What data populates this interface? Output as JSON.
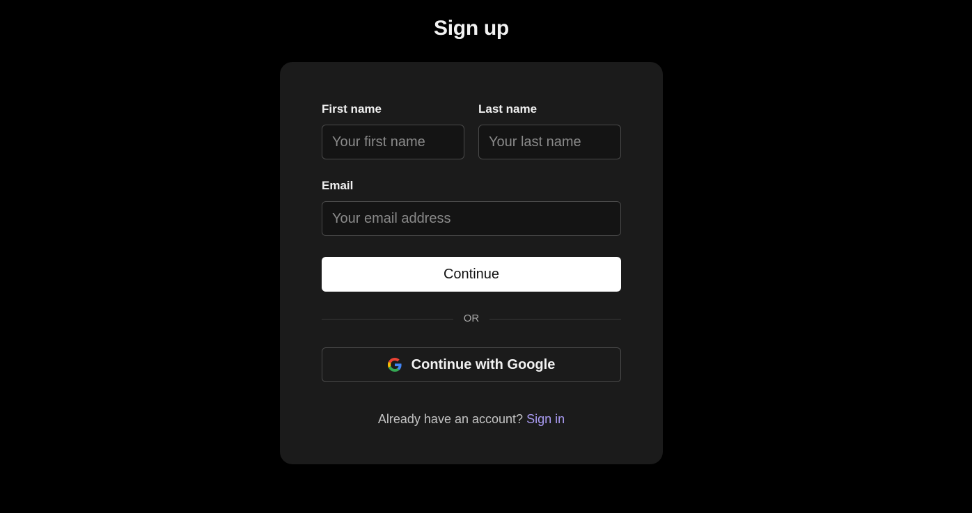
{
  "page": {
    "title": "Sign up"
  },
  "form": {
    "first_name": {
      "label": "First name",
      "placeholder": "Your first name",
      "value": ""
    },
    "last_name": {
      "label": "Last name",
      "placeholder": "Your last name",
      "value": ""
    },
    "email": {
      "label": "Email",
      "placeholder": "Your email address",
      "value": ""
    },
    "continue_label": "Continue",
    "divider_label": "OR",
    "google_label": "Continue with Google",
    "google_icon": "google-g-icon"
  },
  "footer": {
    "prompt": "Already have an account?",
    "link_label": "Sign in"
  },
  "colors": {
    "background": "#000000",
    "card": "#1b1b1b",
    "primary_button": "#ffffff",
    "link": "#a99bf2"
  }
}
